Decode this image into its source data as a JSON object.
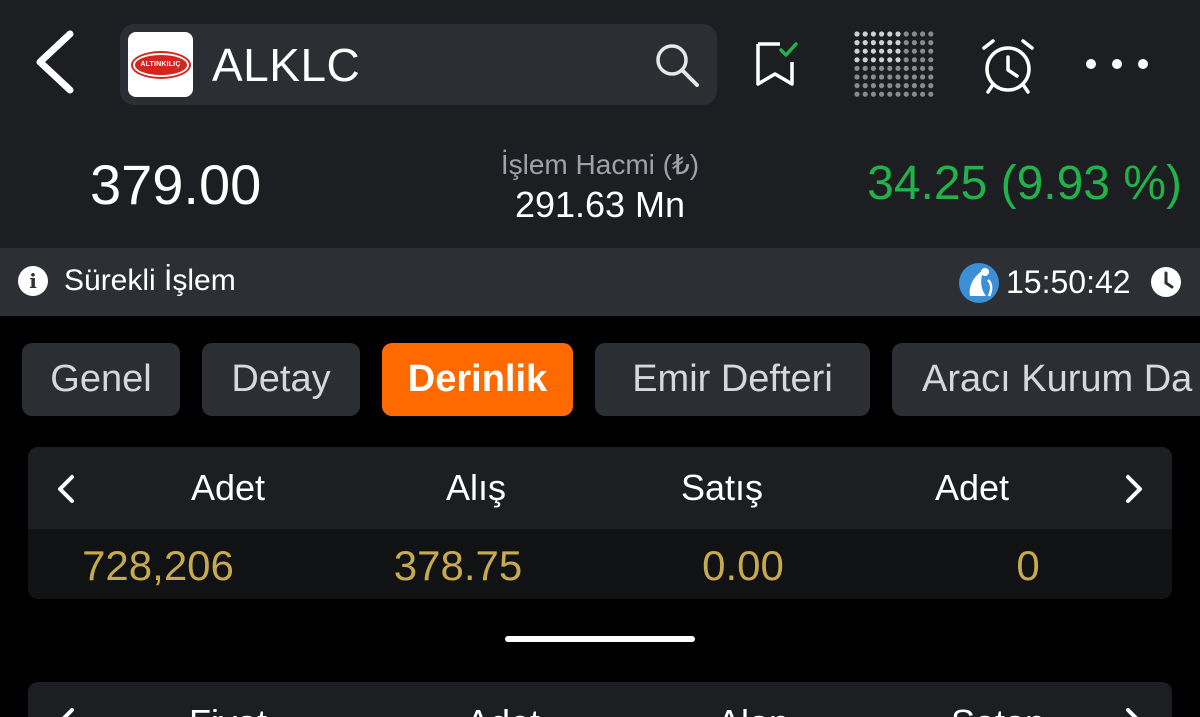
{
  "header": {
    "symbol": "ALKLC",
    "logo_text": "ALTINKILIÇ"
  },
  "quote": {
    "price": "379.00",
    "volume_label": "İşlem Hacmi (₺)",
    "volume_value": "291.63 Mn",
    "change": "34.25 (9.93 %)",
    "change_color": "#21b24b"
  },
  "status": {
    "label": "Sürekli İşlem",
    "time": "15:50:42"
  },
  "tabs": [
    {
      "label": "Genel"
    },
    {
      "label": "Detay"
    },
    {
      "label": "Derinlik",
      "active": true
    },
    {
      "label": "Emir Defteri"
    },
    {
      "label": "Aracı Kurum Da"
    }
  ],
  "depth": {
    "columns": [
      "Adet",
      "Alış",
      "Satış",
      "Adet"
    ],
    "row": [
      "728,206",
      "378.75",
      "0.00",
      "0"
    ],
    "value_color": "#c8aa4e"
  },
  "lower_table": {
    "columns": [
      "Fiyat",
      "Adet",
      "Alan",
      "Satan"
    ]
  },
  "colors": {
    "accent": "#ff6a00",
    "positive": "#21b24b",
    "background": "#000000",
    "panel": "#1c1e21"
  },
  "icons": [
    "back-chevron-icon",
    "search-icon",
    "bookmark-check-icon",
    "dot-grid-icon",
    "alarm-clock-icon",
    "more-dots-icon",
    "info-icon",
    "exchange-logo-icon",
    "clock-icon"
  ]
}
